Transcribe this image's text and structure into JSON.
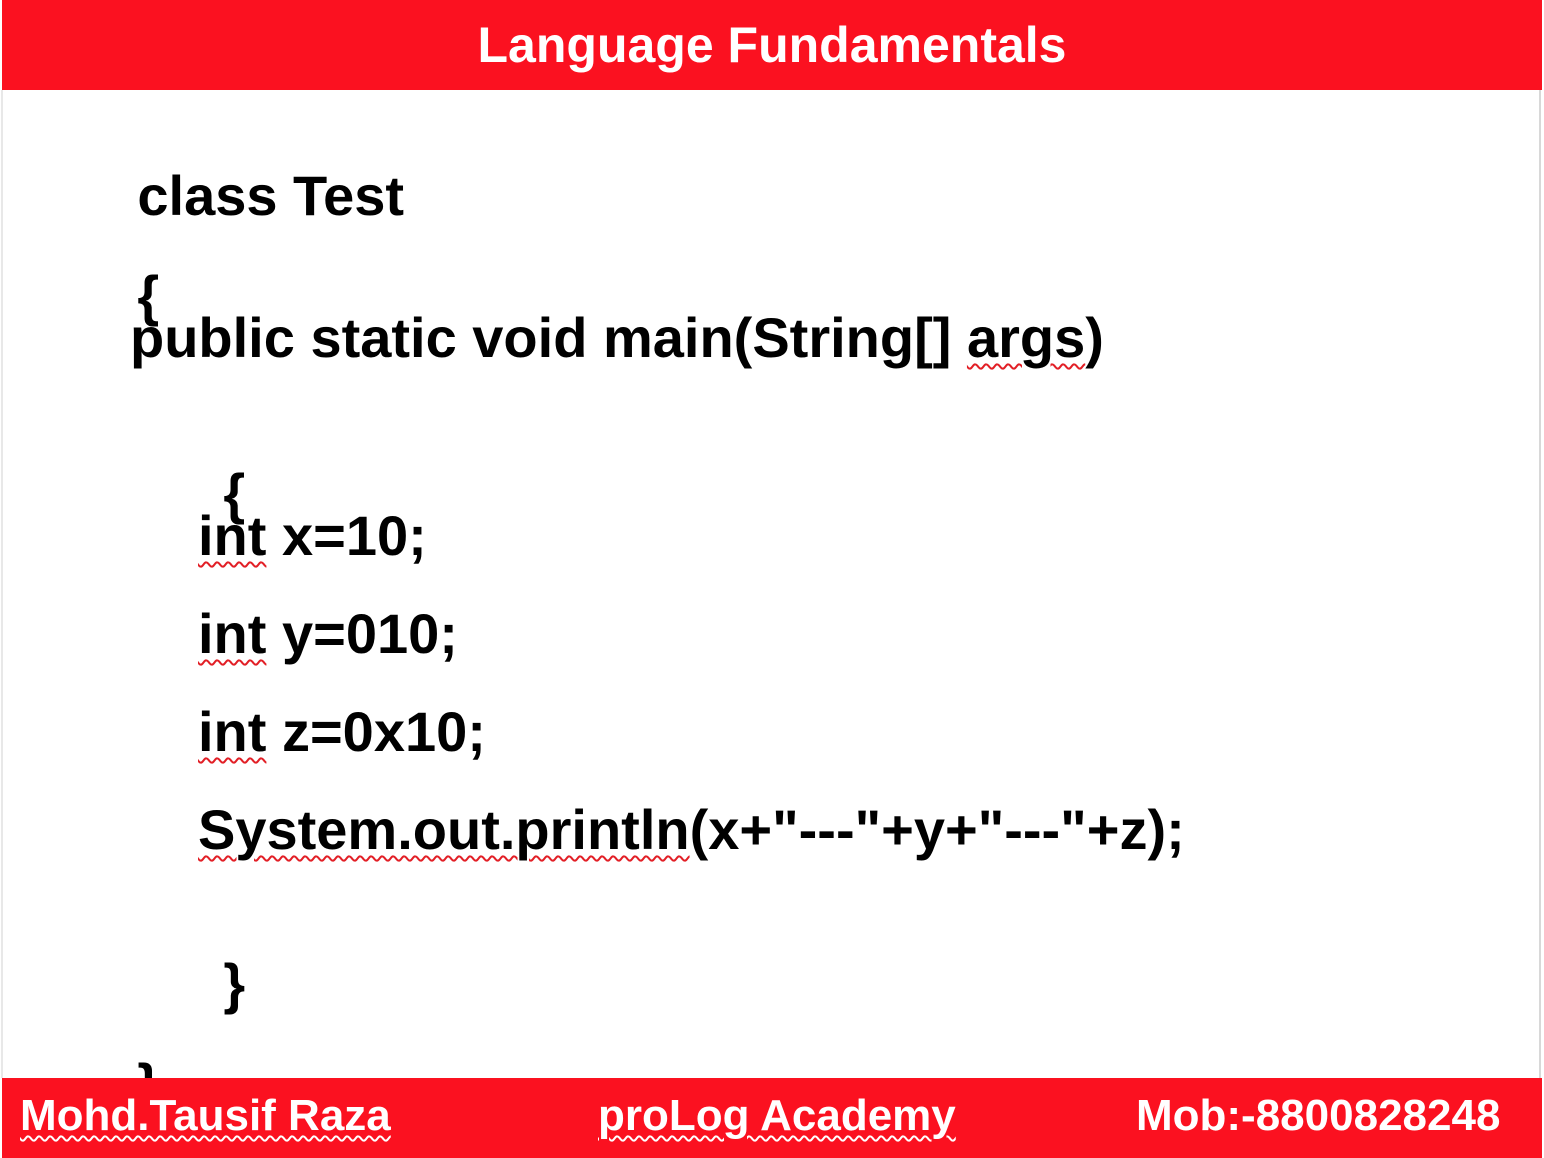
{
  "header": {
    "title": "Language Fundamentals"
  },
  "code": {
    "lines": [
      {
        "text": "class Test"
      },
      {
        "text": "{"
      },
      {
        "text": "public static void main(String[] ",
        "squiggle_word": "args",
        "after": ")"
      },
      {
        "text": "{"
      },
      {
        "squiggle_word": "int",
        "after": " x=10;"
      },
      {
        "squiggle_word": "int",
        "after": " y=010;"
      },
      {
        "squiggle_word": "int",
        "after": " z=0x10;"
      },
      {
        "squiggle_word": "System.out.println",
        "after": "(x+\"---\"+y+\"---\"+z);"
      },
      {
        "text": "}"
      },
      {
        "text": "}"
      }
    ]
  },
  "footer": {
    "author": "Mohd.Tausif Raza",
    "academy": "proLog Academy",
    "mobile": "Mob:-8800828248"
  },
  "colors": {
    "banner": "#fb1120",
    "banner_text": "#ffffff",
    "code_text": "#000000",
    "spellcheck_underline": "#e21f26"
  }
}
